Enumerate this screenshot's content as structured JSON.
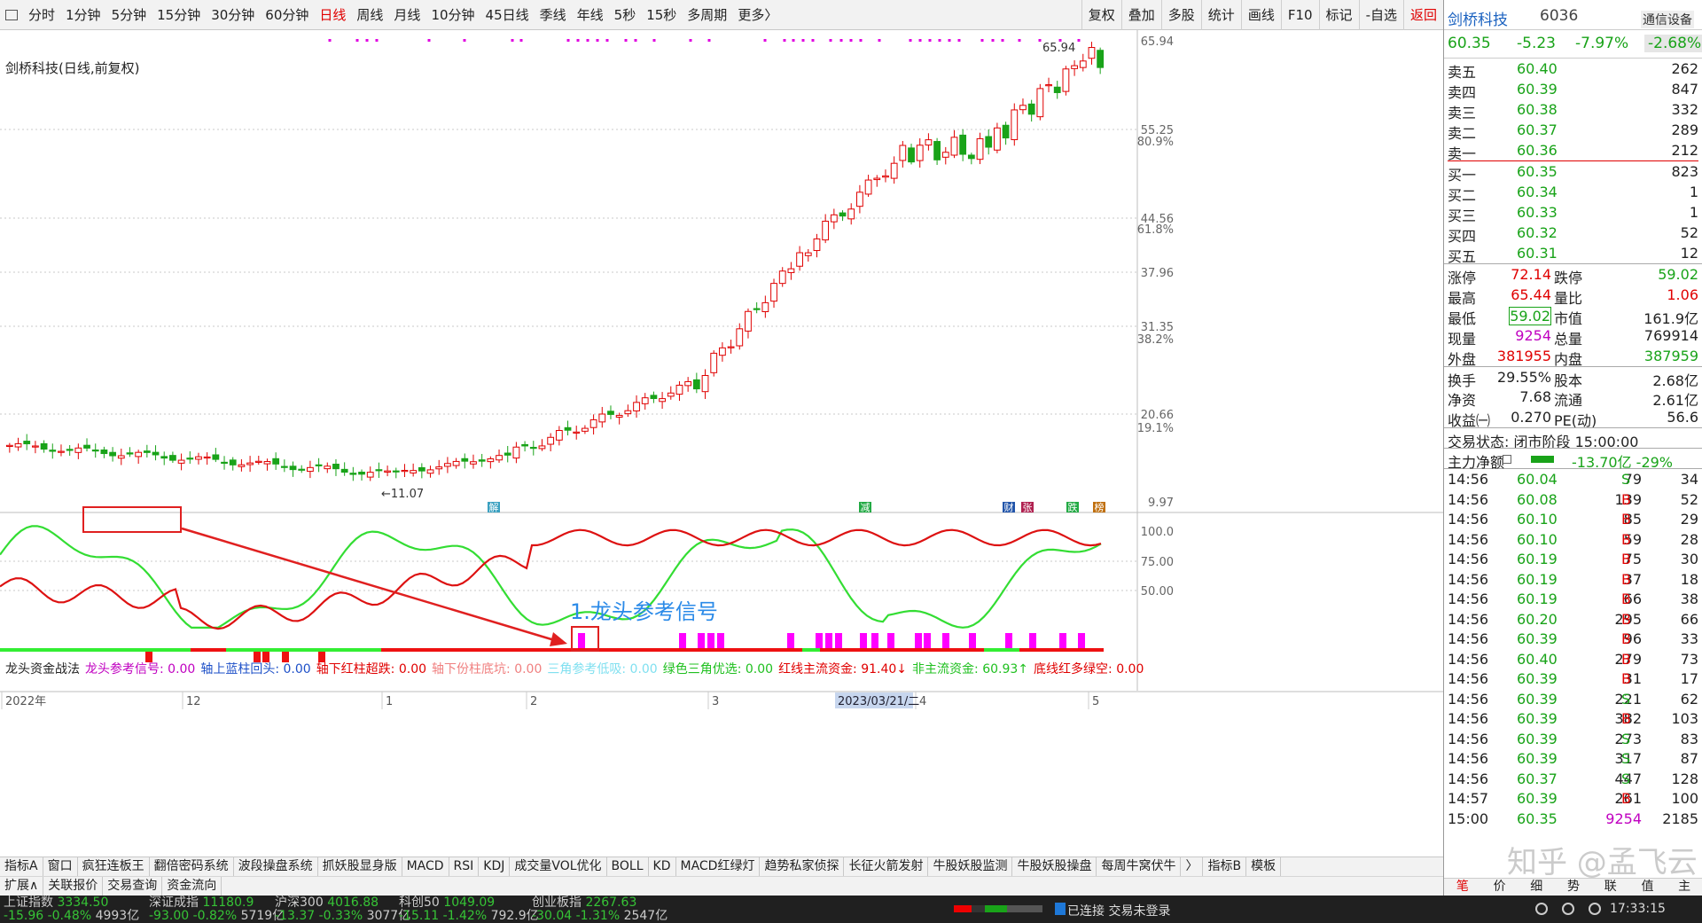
{
  "toolbar": {
    "periods": [
      "分时",
      "1分钟",
      "5分钟",
      "15分钟",
      "30分钟",
      "60分钟",
      "日线",
      "周线",
      "月线",
      "10分钟",
      "45日线",
      "季线",
      "年线",
      "5秒",
      "15秒",
      "多周期",
      "更多〉"
    ],
    "active_period": "日线",
    "tools": [
      "复权",
      "叠加",
      "多股",
      "统计",
      "画线",
      "F10",
      "标记",
      "-自选",
      "返回"
    ]
  },
  "main_chart": {
    "title": "剑桥科技(日线,前复权)",
    "price_labels": [
      "65.94",
      "55.25",
      "44.56",
      "37.96",
      "31.35",
      "20.66",
      "9.97"
    ],
    "pct_labels": [
      "80.9%",
      "61.8%",
      "38.2%",
      "19.1%"
    ],
    "high_marker": "65.94",
    "low_marker": "←11.07",
    "event_markers": [
      {
        "label": "解",
        "color": "#3aa0c0"
      },
      {
        "label": "减",
        "color": "#22aa44"
      },
      {
        "label": "财",
        "color": "#2255aa"
      },
      {
        "label": "张",
        "color": "#b02050"
      },
      {
        "label": "跌",
        "color": "#22aa44"
      },
      {
        "label": "榜",
        "color": "#c07010"
      }
    ]
  },
  "indicator": {
    "name": "龙头资金战法",
    "items": [
      {
        "text": "龙头参考信号: 0.00",
        "color": "#c000c0"
      },
      {
        "text": "轴上蓝柱回头: 0.00",
        "color": "#1e50c8"
      },
      {
        "text": "轴下红柱超跌: 0.00",
        "color": "#e00000"
      },
      {
        "text": "轴下份柱底坑: 0.00",
        "color": "#f08080"
      },
      {
        "text": "三角参考低吸: 0.00",
        "color": "#80e0f0"
      },
      {
        "text": "绿色三角优选: 0.00",
        "color": "#20c020"
      },
      {
        "text": "红线主流资金: 91.40↓",
        "color": "#e00000"
      },
      {
        "text": "非主流资金: 60.93↑",
        "color": "#20c020"
      },
      {
        "text": "底线红多绿空: 0.00",
        "color": "#e00000"
      }
    ],
    "scale": [
      "100.0",
      "75.00",
      "50.00"
    ],
    "annotation": "1.龙头参考信号"
  },
  "x_axis": {
    "labels": [
      "2022年",
      "12",
      "1",
      "2",
      "3",
      "4",
      "5"
    ],
    "highlight_date": "2023/03/21/二"
  },
  "bottom_tabs": [
    "指标A",
    "窗口",
    "疯狂连板王",
    "翻倍密码系统",
    "波段操盘系统",
    "抓妖股显身版",
    "MACD",
    "RSI",
    "KDJ",
    "成交量VOL优化",
    "BOLL",
    "KD",
    "MACD红绿灯",
    "趋势私家侦探",
    "长征火箭发射",
    "牛股妖股监测",
    "牛股妖股操盘",
    "每周牛窝伏牛",
    "〉",
    "指标B",
    "模板"
  ],
  "bottom_tabs2": [
    "扩展∧",
    "关联报价",
    "交易查询",
    "资金流向"
  ],
  "status": {
    "indices": [
      {
        "name": "上证指数",
        "value": "3334.50",
        "change": "-15.96",
        "pct": "-0.48%",
        "amount": "4993亿"
      },
      {
        "name": "深证成指",
        "value": "11180.9",
        "change": "-93.00",
        "pct": "-0.82%",
        "amount": "5719亿"
      },
      {
        "name": "沪深300",
        "value": "4016.88",
        "change": "-13.37",
        "pct": "-0.33%",
        "amount": "3077亿"
      },
      {
        "name": "科创50",
        "value": "1049.09",
        "change": "-15.11",
        "pct": "-1.42%",
        "amount": "792.9亿"
      },
      {
        "name": "创业板指",
        "value": "2267.63",
        "change": "-30.04",
        "pct": "-1.31%",
        "amount": "2547亿"
      }
    ],
    "connection": "已连接 交易未登录",
    "clock": "17:33:15"
  },
  "panel": {
    "name": "剑桥科技",
    "code": "6036",
    "sector": "通信设备",
    "price": "60.35",
    "change": "-5.23",
    "pct": "-7.97%",
    "pct2": "-2.68%",
    "asks": [
      {
        "label": "卖五",
        "price": "60.40",
        "vol": "262"
      },
      {
        "label": "卖四",
        "price": "60.39",
        "vol": "847"
      },
      {
        "label": "卖三",
        "price": "60.38",
        "vol": "332"
      },
      {
        "label": "卖二",
        "price": "60.37",
        "vol": "289"
      },
      {
        "label": "卖一",
        "price": "60.36",
        "vol": "212"
      }
    ],
    "bids": [
      {
        "label": "买一",
        "price": "60.35",
        "vol": "823"
      },
      {
        "label": "买二",
        "price": "60.34",
        "vol": "1"
      },
      {
        "label": "买三",
        "price": "60.33",
        "vol": "1"
      },
      {
        "label": "买四",
        "price": "60.32",
        "vol": "52"
      },
      {
        "label": "买五",
        "price": "60.31",
        "vol": "12"
      }
    ],
    "stats": [
      {
        "l1": "涨停",
        "v1": "72.14",
        "c1": "red",
        "l2": "跌停",
        "v2": "59.02",
        "c2": "green"
      },
      {
        "l1": "最高",
        "v1": "65.44",
        "c1": "red",
        "l2": "量比",
        "v2": "1.06",
        "c2": "red"
      },
      {
        "l1": "最低",
        "v1": "59.02",
        "c1": "green",
        "l2": "市值",
        "v2": "161.9亿",
        "c2": "dark"
      },
      {
        "l1": "现量",
        "v1": "9254",
        "c1": "magenta",
        "l2": "总量",
        "v2": "769914",
        "c2": "dark"
      },
      {
        "l1": "外盘",
        "v1": "381955",
        "c1": "red",
        "l2": "内盘",
        "v2": "387959",
        "c2": "green"
      },
      {
        "l1": "换手",
        "v1": "29.55%",
        "c1": "dark",
        "l2": "股本",
        "v2": "2.68亿",
        "c2": "dark"
      },
      {
        "l1": "净资",
        "v1": "7.68",
        "c1": "dark",
        "l2": "流通",
        "v2": "2.61亿",
        "c2": "dark"
      },
      {
        "l1": "收益㈠",
        "v1": "0.270",
        "c1": "dark",
        "l2": "PE(动)",
        "v2": "56.6",
        "c2": "dark"
      }
    ],
    "trade_state": "交易状态: 闭市阶段 15:00:00",
    "main_flow_label": "主力净额",
    "main_flow_value": "-13.70亿 -29%",
    "ticks": [
      {
        "t": "14:56",
        "p": "60.04",
        "v": "79",
        "s": "S",
        "n": "34"
      },
      {
        "t": "14:56",
        "p": "60.08",
        "v": "139",
        "s": "B",
        "n": "52"
      },
      {
        "t": "14:56",
        "p": "60.10",
        "v": "85",
        "s": "B",
        "n": "29"
      },
      {
        "t": "14:56",
        "p": "60.10",
        "v": "59",
        "s": "B",
        "n": "28"
      },
      {
        "t": "14:56",
        "p": "60.19",
        "v": "75",
        "s": "B",
        "n": "30"
      },
      {
        "t": "14:56",
        "p": "60.19",
        "v": "37",
        "s": "B",
        "n": "18"
      },
      {
        "t": "14:56",
        "p": "60.19",
        "v": "66",
        "s": "B",
        "n": "38"
      },
      {
        "t": "14:56",
        "p": "60.20",
        "v": "295",
        "s": "B",
        "n": "66"
      },
      {
        "t": "14:56",
        "p": "60.39",
        "v": "96",
        "s": "B",
        "n": "33"
      },
      {
        "t": "14:56",
        "p": "60.40",
        "v": "279",
        "s": "B",
        "n": "73"
      },
      {
        "t": "14:56",
        "p": "60.39",
        "v": "31",
        "s": "B",
        "n": "17"
      },
      {
        "t": "14:56",
        "p": "60.39",
        "v": "221",
        "s": "S",
        "n": "62"
      },
      {
        "t": "14:56",
        "p": "60.39",
        "v": "382",
        "s": "B",
        "n": "103"
      },
      {
        "t": "14:56",
        "p": "60.39",
        "v": "273",
        "s": "S",
        "n": "83"
      },
      {
        "t": "14:56",
        "p": "60.39",
        "v": "317",
        "s": "S",
        "n": "87"
      },
      {
        "t": "14:56",
        "p": "60.37",
        "v": "447",
        "s": "S",
        "n": "128"
      },
      {
        "t": "14:57",
        "p": "60.39",
        "v": "261",
        "s": "B",
        "n": "100"
      },
      {
        "t": "15:00",
        "p": "60.35",
        "v": "9254",
        "s": "",
        "n": "2185"
      }
    ],
    "bottom_tabs": [
      "笔",
      "价",
      "细",
      "势",
      "联",
      "值",
      "主"
    ]
  },
  "watermark": "知乎 @孟飞云",
  "colors": {
    "up": "#e00000",
    "down": "#19a319",
    "signal": "#ff00ff"
  }
}
